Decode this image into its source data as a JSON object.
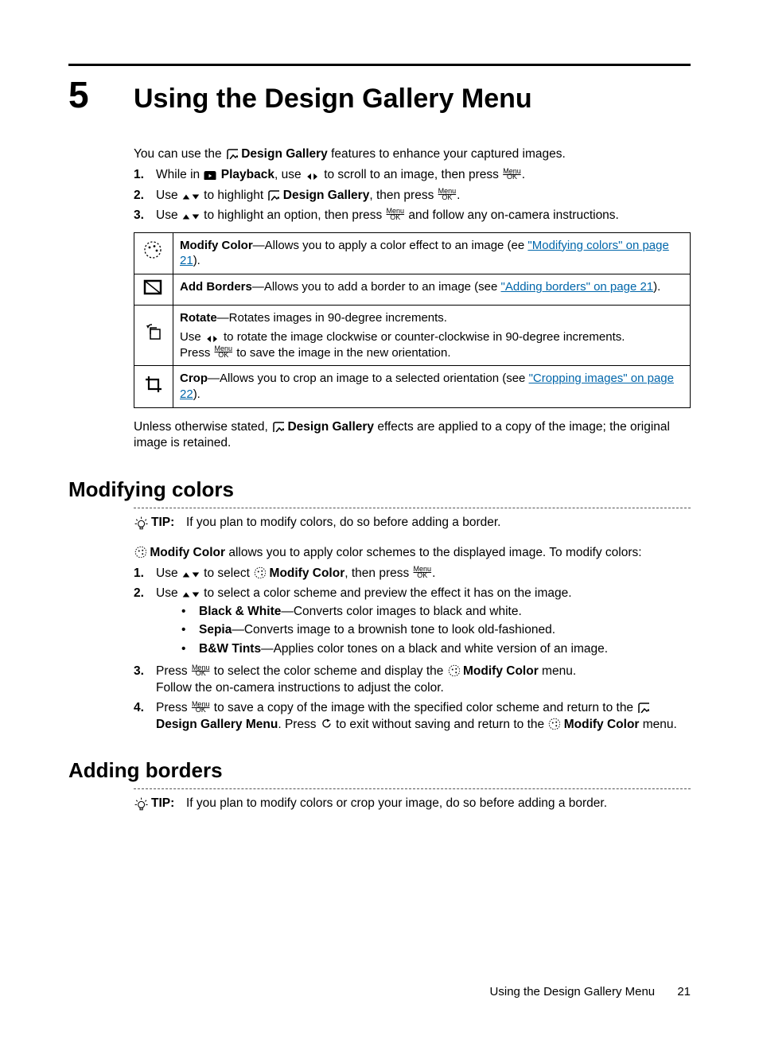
{
  "chapter": {
    "number": "5",
    "title": "Using the Design Gallery Menu"
  },
  "intro": {
    "prefix": "You can use the ",
    "design_gallery": "Design Gallery",
    "suffix": " features to enhance your captured images."
  },
  "steps_top": [
    {
      "n": "1.",
      "parts": [
        "While in ",
        "Playback",
        ", use ",
        " to scroll to an image, then press ",
        "."
      ]
    },
    {
      "n": "2.",
      "parts": [
        "Use ",
        " to highlight ",
        "Design Gallery",
        ", then press ",
        "."
      ]
    },
    {
      "n": "3.",
      "parts": [
        "Use ",
        " to highlight an option, then press ",
        " and follow any on-camera instructions."
      ]
    }
  ],
  "table": {
    "rows": [
      {
        "title": "Modify Color",
        "desc": "—Allows you to apply a color effect to an image (ee ",
        "link": "\"Modifying colors\" on page 21",
        "tail": ")."
      },
      {
        "title": "Add Borders",
        "desc": "—Allows you to add a border to an image (see ",
        "link": "\"Adding borders\" on page 21",
        "tail": ")."
      },
      {
        "title": "Rotate",
        "desc": "—Rotates images in 90-degree increments.",
        "extra1a": "Use ",
        "extra1b": " to rotate the image clockwise or counter-clockwise in 90-degree increments.",
        "extra2a": "Press ",
        "extra2b": " to save the image in the new orientation."
      },
      {
        "title": "Crop",
        "desc": "—Allows you to crop an image to a selected orientation (see ",
        "link": "\"Cropping images\" on page 22",
        "tail": ")."
      }
    ]
  },
  "after_table": {
    "a": "Unless otherwise stated, ",
    "b": "Design Gallery",
    "c": " effects are applied to a copy of the image; the original image is retained."
  },
  "section1": {
    "title": "Modifying colors"
  },
  "tip1": {
    "label": "TIP:",
    "text": "If you plan to modify colors, do so before adding a border."
  },
  "mc_intro": {
    "a": "Modify Color",
    "b": " allows you to apply color schemes to the displayed image. To modify colors:"
  },
  "mc_steps": {
    "s1": {
      "n": "1.",
      "a": "Use ",
      "b": " to select ",
      "c": "Modify Color",
      "d": ", then press ",
      "e": "."
    },
    "s2": {
      "n": "2.",
      "a": "Use ",
      "b": " to select a color scheme and preview the effect it has on the image."
    },
    "b1": {
      "t": "Black & White",
      "d": "—Converts color images to black and white."
    },
    "b2": {
      "t": "Sepia",
      "d": "—Converts image to a brownish tone to look old-fashioned."
    },
    "b3": {
      "t": "B&W Tints",
      "d": "—Applies color tones on a black and white version of an image."
    },
    "s3": {
      "n": "3.",
      "a": "Press ",
      "b": " to select the color scheme and display the ",
      "c": "Modify Color",
      "d": " menu.",
      "e": "Follow the on-camera instructions to adjust the color."
    },
    "s4": {
      "n": "4.",
      "a": "Press ",
      "b": " to save a copy of the image with the specified color scheme and return to the ",
      "c": "Design Gallery Menu",
      "d": ". Press ",
      "e": " to exit without saving and return to the ",
      "f": "Modify Color",
      "g": " menu."
    }
  },
  "section2": {
    "title": "Adding borders"
  },
  "tip2": {
    "label": "TIP:",
    "text": "If you plan to modify colors or crop your image, do so before adding a border."
  },
  "footer": {
    "text": "Using the Design Gallery Menu",
    "page": "21"
  }
}
